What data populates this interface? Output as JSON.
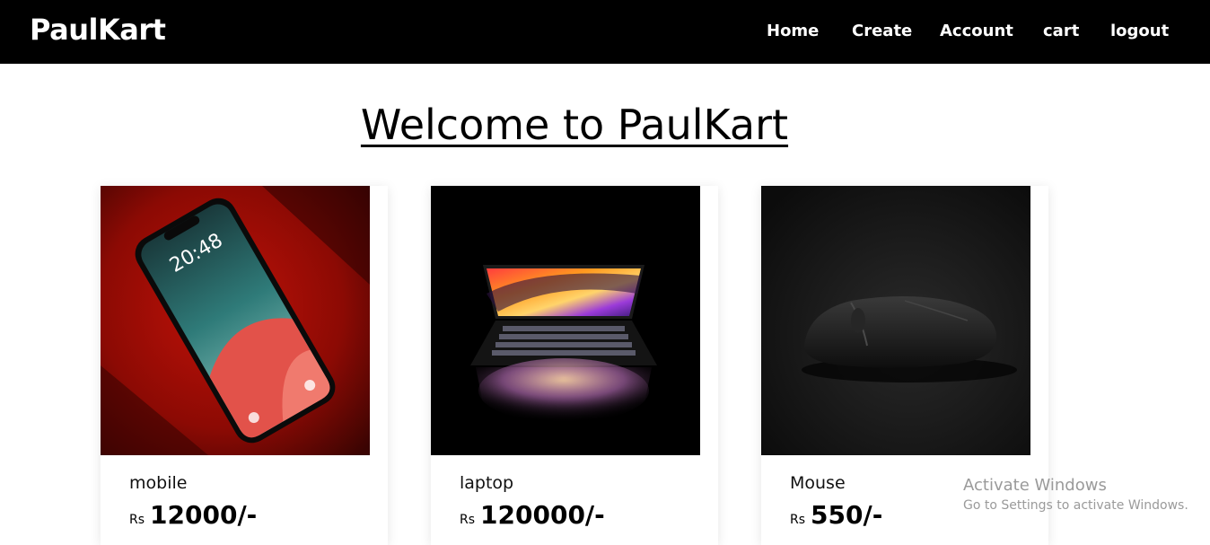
{
  "navbar": {
    "brand": "PaulKart",
    "links": [
      {
        "label": "Home"
      },
      {
        "label": "Create"
      },
      {
        "label": "Account"
      },
      {
        "label": "cart"
      },
      {
        "label": "logout"
      }
    ]
  },
  "main": {
    "title": "Welcome to PaulKart"
  },
  "products": [
    {
      "name": "mobile",
      "currency": "Rs",
      "price": "12000/-",
      "image": "red-smartphone-photo"
    },
    {
      "name": "laptop",
      "currency": "Rs",
      "price": "120000/-",
      "image": "open-laptop-dark-photo"
    },
    {
      "name": "Mouse",
      "currency": "Rs",
      "price": "550/-",
      "image": "black-mouse-photo"
    }
  ],
  "watermark": {
    "title": "Activate Windows",
    "subtitle": "Go to Settings to activate Windows."
  },
  "colors": {
    "navbar_bg": "#000000",
    "nav_text": "#ffffff",
    "watermark_text": "#9a9a9a"
  }
}
